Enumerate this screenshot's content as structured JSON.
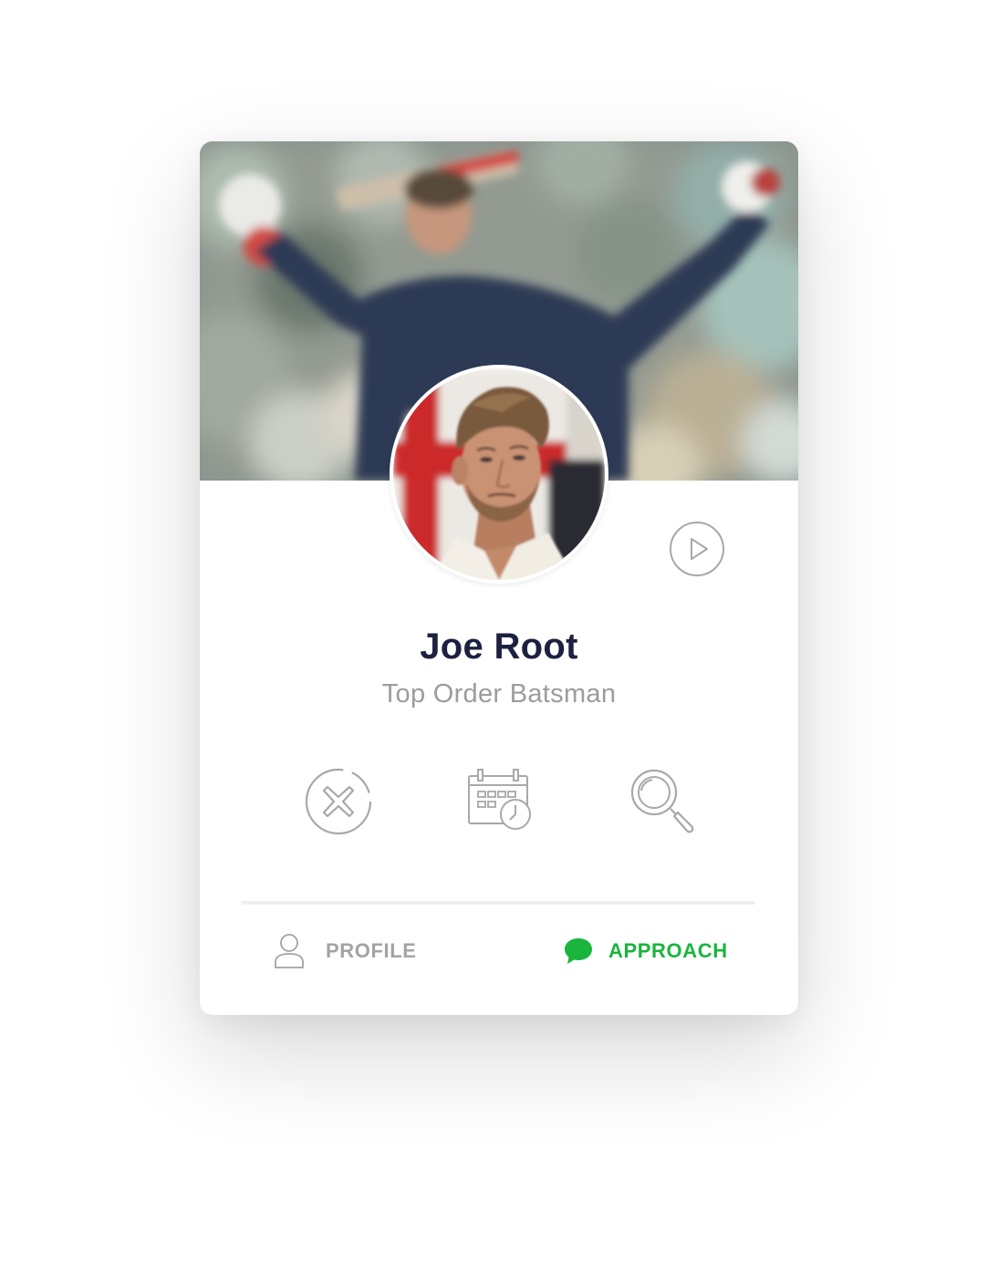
{
  "profile": {
    "name": "Joe Root",
    "role": "Top Order Batsman"
  },
  "actions": [
    {
      "icon": "close-circle-icon"
    },
    {
      "icon": "calendar-clock-icon"
    },
    {
      "icon": "search-icon"
    }
  ],
  "footer": {
    "profile_label": "PROFILE",
    "approach_label": "APPROACH"
  },
  "colors": {
    "name": "#1c2140",
    "muted": "#9c9c9c",
    "icon_stroke": "#a8a8a8",
    "accent_green": "#19b53c",
    "divider": "#efefef"
  }
}
